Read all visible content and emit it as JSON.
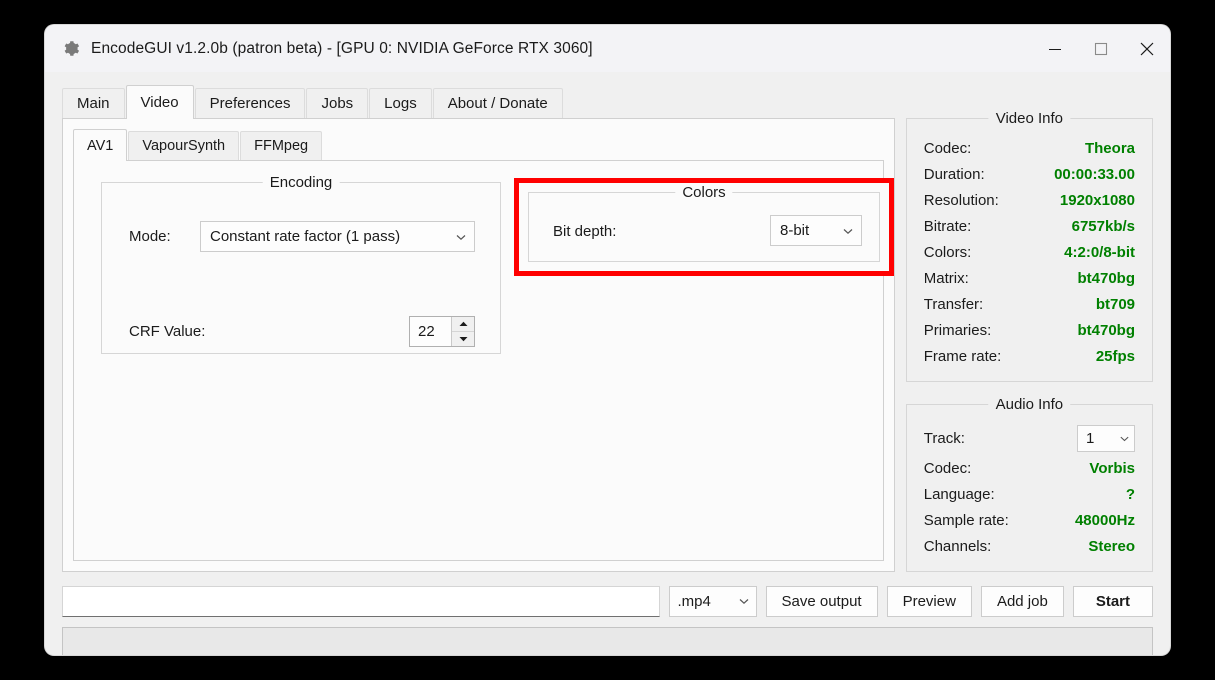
{
  "window": {
    "title": "EncodeGUI v1.2.0b (patron beta) - [GPU 0: NVIDIA GeForce RTX 3060]",
    "icon": "gear-icon",
    "controls": {
      "minimize": "minimize-icon",
      "maximize": "maximize-icon",
      "close": "close-icon"
    }
  },
  "tabs": [
    {
      "label": "Main",
      "selected": false
    },
    {
      "label": "Video",
      "selected": true
    },
    {
      "label": "Preferences",
      "selected": false
    },
    {
      "label": "Jobs",
      "selected": false
    },
    {
      "label": "Logs",
      "selected": false
    },
    {
      "label": "About / Donate",
      "selected": false
    }
  ],
  "subtabs": [
    {
      "label": "AV1",
      "selected": true
    },
    {
      "label": "VapourSynth",
      "selected": false
    },
    {
      "label": "FFMpeg",
      "selected": false
    }
  ],
  "encoding": {
    "title": "Encoding",
    "mode_label": "Mode:",
    "mode_value": "Constant rate factor (1 pass)",
    "crf_label": "CRF Value:",
    "crf_value": "22"
  },
  "colors": {
    "title": "Colors",
    "bit_depth_label": "Bit depth:",
    "bit_depth_value": "8-bit",
    "highlight_color": "#ff0000"
  },
  "video_info": {
    "title": "Video Info",
    "value_color": "#008000",
    "rows": [
      {
        "key": "Codec:",
        "value": "Theora"
      },
      {
        "key": "Duration:",
        "value": "00:00:33.00"
      },
      {
        "key": "Resolution:",
        "value": "1920x1080"
      },
      {
        "key": "Bitrate:",
        "value": "6757kb/s"
      },
      {
        "key": "Colors:",
        "value": "4:2:0/8-bit"
      },
      {
        "key": "Matrix:",
        "value": "bt470bg"
      },
      {
        "key": "Transfer:",
        "value": "bt709"
      },
      {
        "key": "Primaries:",
        "value": "bt470bg"
      },
      {
        "key": "Frame rate:",
        "value": "25fps"
      }
    ]
  },
  "audio_info": {
    "title": "Audio Info",
    "track_label": "Track:",
    "track_value": "1",
    "rows": [
      {
        "key": "Codec:",
        "value": "Vorbis"
      },
      {
        "key": "Language:",
        "value": "?"
      },
      {
        "key": "Sample rate:",
        "value": "48000Hz"
      },
      {
        "key": "Channels:",
        "value": "Stereo"
      }
    ]
  },
  "bottom": {
    "output_path": "",
    "output_placeholder": "",
    "extension": ".mp4",
    "save_output": "Save output",
    "preview": "Preview",
    "add_job": "Add job",
    "start": "Start"
  },
  "status": {
    "text": ""
  }
}
